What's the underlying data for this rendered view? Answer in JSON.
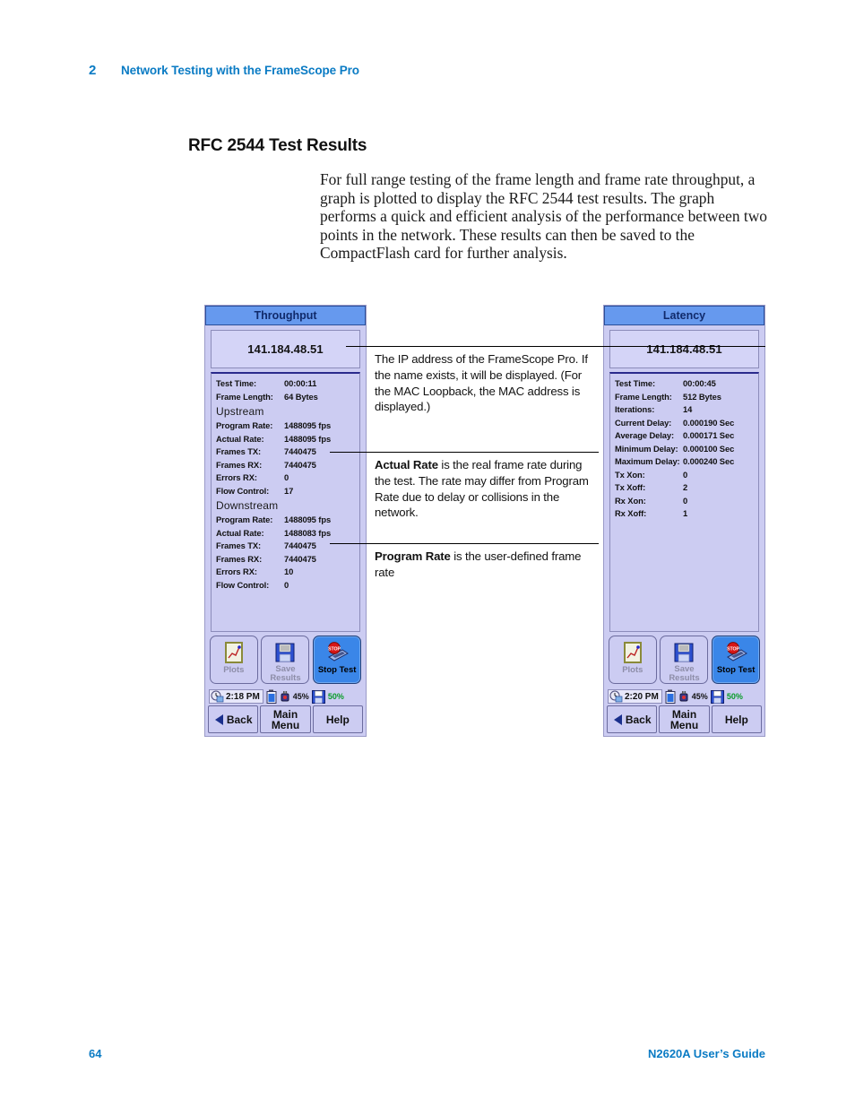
{
  "running_head": {
    "chapter_number": "2",
    "chapter_title": "Network Testing with the FrameScope Pro"
  },
  "section": {
    "heading": "RFC 2544 Test Results",
    "paragraph": "For full range testing of the frame length and frame rate throughput, a graph is plotted to display the RFC 2544 test results. The graph performs a quick and efficient analysis of the performance between two points in the network. These results can then be saved to the CompactFlash card for further analysis."
  },
  "devices": {
    "throughput": {
      "title": "Throughput",
      "ip_address": "141.184.48.51",
      "summary_rows": [
        {
          "label": "Test Time:",
          "value": "00:00:11"
        },
        {
          "label": "Frame Length:",
          "value": "64 Bytes"
        }
      ],
      "upstream_header": "Upstream",
      "upstream_rows": [
        {
          "label": "Program Rate:",
          "value": "1488095 fps"
        },
        {
          "label": "Actual Rate:",
          "value": "1488095 fps"
        },
        {
          "label": "Frames TX:",
          "value": "7440475"
        },
        {
          "label": "Frames RX:",
          "value": "7440475"
        },
        {
          "label": "Errors RX:",
          "value": "0"
        },
        {
          "label": "Flow Control:",
          "value": "17"
        }
      ],
      "downstream_header": "Downstream",
      "downstream_rows": [
        {
          "label": "Program Rate:",
          "value": "1488095 fps"
        },
        {
          "label": "Actual Rate:",
          "value": "1488083 fps"
        },
        {
          "label": "Frames TX:",
          "value": "7440475"
        },
        {
          "label": "Frames RX:",
          "value": "7440475"
        },
        {
          "label": "Errors RX:",
          "value": "10"
        },
        {
          "label": "Flow Control:",
          "value": "0"
        }
      ],
      "buttons": {
        "plots": "Plots",
        "save_results": "Save Results",
        "stop_test": "Stop Test"
      },
      "status": {
        "time": "2:18 PM",
        "battery_percent": "45%",
        "storage_percent": "50%"
      },
      "nav": {
        "back": "Back",
        "main_menu": "Main Menu",
        "help": "Help"
      }
    },
    "latency": {
      "title": "Latency",
      "ip_address": "141.184.48.51",
      "rows": [
        {
          "label": "Test Time:",
          "value": "00:00:45"
        },
        {
          "label": "Frame Length:",
          "value": "512 Bytes"
        },
        {
          "label": "Iterations:",
          "value": "14"
        },
        {
          "label": "Current Delay:",
          "value": "0.000190 Sec"
        },
        {
          "label": "Average Delay:",
          "value": "0.000171 Sec"
        },
        {
          "label": "Minimum Delay:",
          "value": "0.000100 Sec"
        },
        {
          "label": "Maximum Delay:",
          "value": "0.000240 Sec"
        },
        {
          "label": "Tx Xon:",
          "value": "0"
        },
        {
          "label": "Tx Xoff:",
          "value": "2"
        },
        {
          "label": "Rx Xon:",
          "value": "0"
        },
        {
          "label": "Rx Xoff:",
          "value": "1"
        }
      ],
      "buttons": {
        "plots": "Plots",
        "save_results": "Save Results",
        "stop_test": "Stop Test"
      },
      "status": {
        "time": "2:20 PM",
        "battery_percent": "45%",
        "storage_percent": "50%"
      },
      "nav": {
        "back": "Back",
        "main_menu": "Main Menu",
        "help": "Help"
      }
    }
  },
  "callouts": {
    "ip_address": "The IP address of the FrameScope Pro. If the name exists, it will be displayed. (For the MAC Loopback, the MAC address is displayed.)",
    "actual_rate_bold": "Actual Rate",
    "actual_rate_text": " is the real frame rate during the test. The rate may differ from Program Rate due to delay or collisions in the network.",
    "program_rate_bold": "Program Rate",
    "program_rate_text": " is the user-defined frame rate"
  },
  "footer": {
    "page_number": "64",
    "guide_title": "N2620A User’s Guide"
  },
  "colors": {
    "accent_blue": "#0a7bc4",
    "titlebar_blue": "#6699ee",
    "panel_lavender": "#ccccf2",
    "active_button_blue": "#3a86e8",
    "stop_red": "#d81515",
    "storage_green": "#089c28"
  }
}
